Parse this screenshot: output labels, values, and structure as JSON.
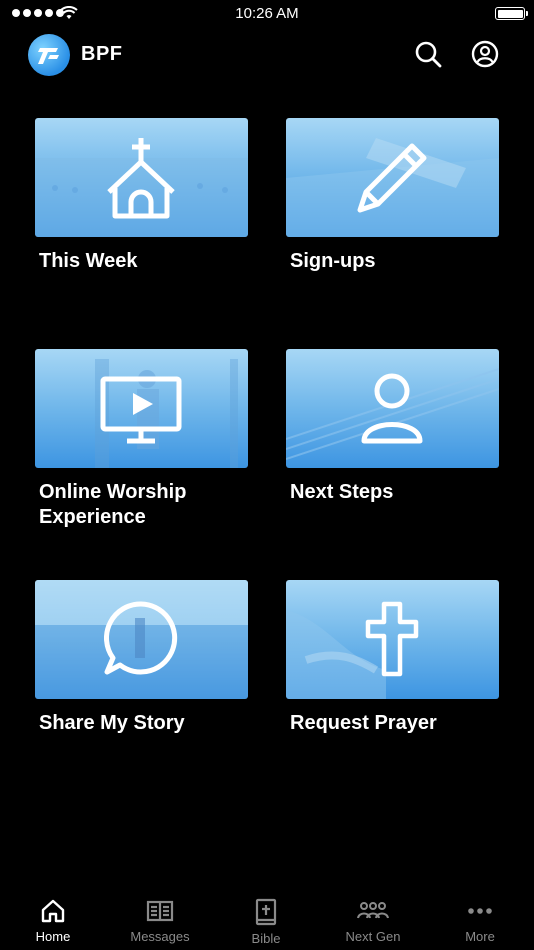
{
  "status": {
    "time": "10:26 AM"
  },
  "header": {
    "brand": "BPF"
  },
  "tiles": [
    {
      "label": "This Week",
      "icon": "church-icon"
    },
    {
      "label": "Sign-ups",
      "icon": "pencil-icon"
    },
    {
      "label": "Online Worship Experience",
      "icon": "tv-play-icon"
    },
    {
      "label": "Next Steps",
      "icon": "person-icon"
    },
    {
      "label": "Share My Story",
      "icon": "chat-bubble-icon"
    },
    {
      "label": "Request Prayer",
      "icon": "cross-icon"
    }
  ],
  "tabs": [
    {
      "label": "Home",
      "icon": "home-icon",
      "active": true
    },
    {
      "label": "Messages",
      "icon": "book-icon"
    },
    {
      "label": "Bible",
      "icon": "bible-icon"
    },
    {
      "label": "Next Gen",
      "icon": "group-icon"
    },
    {
      "label": "More",
      "icon": "more-dots-icon"
    }
  ],
  "colors": {
    "tile_gradient_top": "#a7d7f5",
    "tile_gradient_bottom": "#3d95e2",
    "tab_inactive": "#8a8a8a"
  }
}
